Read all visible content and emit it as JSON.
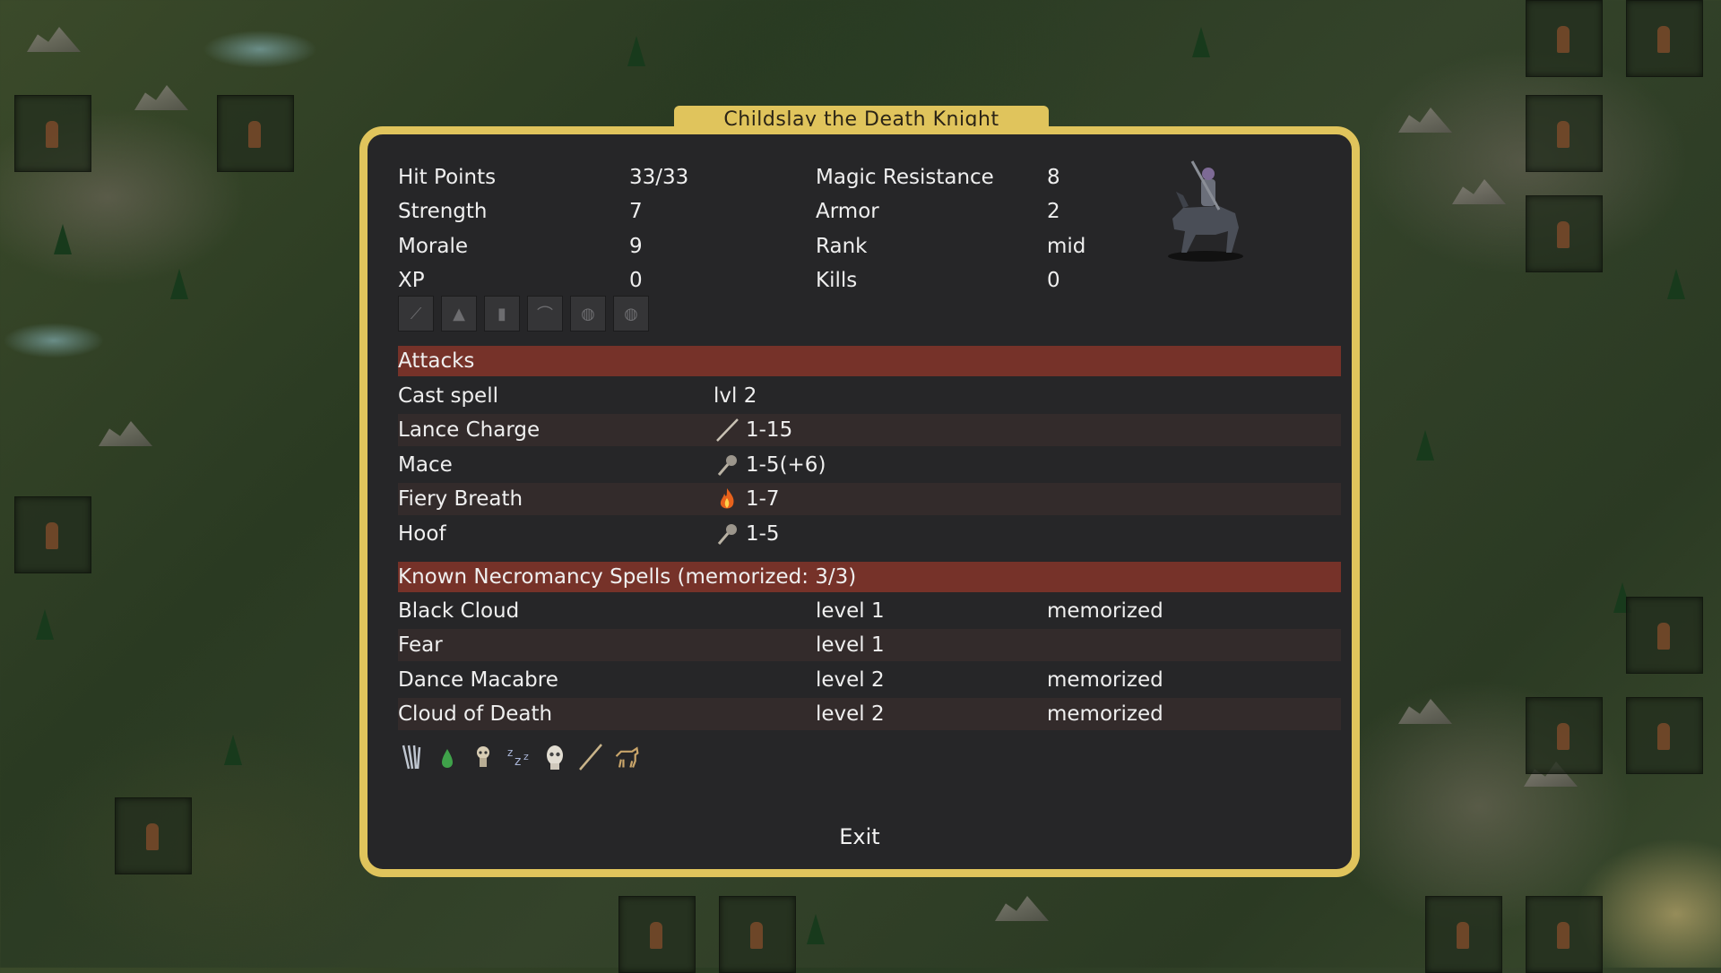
{
  "dialog": {
    "title": "Childslay the Death Knight",
    "stats_left": [
      {
        "label": "Hit Points",
        "value": "33/33"
      },
      {
        "label": "Strength",
        "value": "7"
      },
      {
        "label": "Morale",
        "value": "9"
      },
      {
        "label": "XP",
        "value": "0"
      }
    ],
    "stats_right": [
      {
        "label": "Magic Resistance",
        "value": "8"
      },
      {
        "label": "Armor",
        "value": "2"
      },
      {
        "label": "Rank",
        "value": "mid"
      },
      {
        "label": "Kills",
        "value": "0"
      }
    ],
    "equipment_slots": [
      "sword-slot-icon",
      "helmet-slot-icon",
      "armor-slot-icon",
      "boots-slot-icon",
      "ring-slot-icon",
      "amulet-slot-icon"
    ],
    "attacks_header": "Attacks",
    "attacks": [
      {
        "name": "Cast spell",
        "icon": "",
        "value": "lvl 2"
      },
      {
        "name": "Lance Charge",
        "icon": "lance-icon",
        "value": "1-15"
      },
      {
        "name": "Mace",
        "icon": "mace-icon",
        "value": "1-5(+6)"
      },
      {
        "name": "Fiery Breath",
        "icon": "fire-icon",
        "value": "1-7"
      },
      {
        "name": "Hoof",
        "icon": "hoof-icon",
        "value": "1-5"
      }
    ],
    "spells_header": "Known Necromancy Spells (memorized: 3/3)",
    "spells": [
      {
        "name": "Black Cloud",
        "level": "level 1",
        "status": "memorized"
      },
      {
        "name": "Fear",
        "level": "level 1",
        "status": ""
      },
      {
        "name": "Dance Macabre",
        "level": "level 2",
        "status": "memorized"
      },
      {
        "name": "Cloud of Death",
        "level": "level 2",
        "status": "memorized"
      }
    ],
    "status_icons": [
      "claws-icon",
      "poison-drop-icon",
      "undead-skull-icon",
      "sleepless-icon",
      "skull-icon",
      "lance-icon",
      "mount-icon"
    ],
    "exit_label": "Exit"
  },
  "colors": {
    "frame": "#e0c45c",
    "panel": "#262628",
    "section_header": "#763229",
    "row_alt": "#332b2b"
  }
}
